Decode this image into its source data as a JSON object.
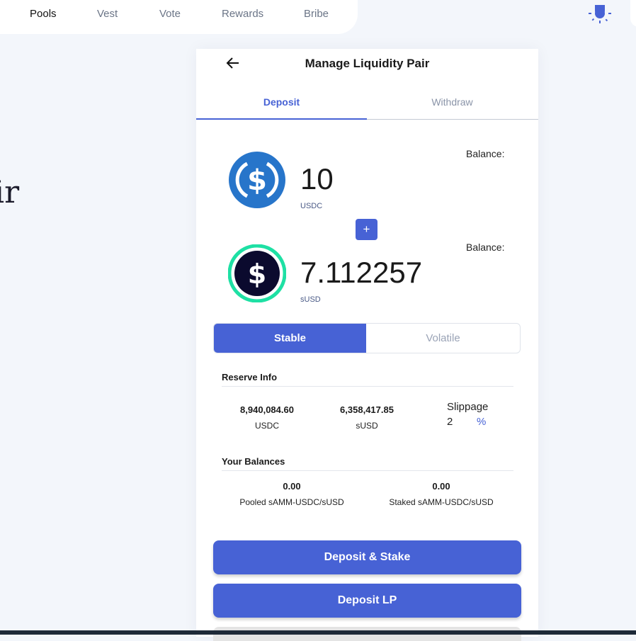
{
  "nav": {
    "items": [
      {
        "label": "Pools",
        "active": true
      },
      {
        "label": "Vest",
        "active": false
      },
      {
        "label": "Vote",
        "active": false
      },
      {
        "label": "Rewards",
        "active": false
      },
      {
        "label": "Bribe",
        "active": false
      }
    ],
    "theme_icon": "sun-icon"
  },
  "background_title_fragment": "ir",
  "card": {
    "back_icon": "arrow-left-icon",
    "title": "Manage Liquidity Pair",
    "tabs": [
      {
        "label": "Deposit",
        "active": true
      },
      {
        "label": "Withdraw",
        "active": false
      }
    ],
    "token_a": {
      "amount": "10",
      "symbol": "USDC",
      "balance_label": "Balance:",
      "icon": "usdc-icon"
    },
    "plus_label": "+",
    "token_b": {
      "amount": "7.112257",
      "symbol": "sUSD",
      "balance_label": "Balance:",
      "icon": "susd-icon"
    },
    "pool_type": {
      "stable": "Stable",
      "volatile": "Volatile",
      "selected": "Stable"
    },
    "reserve": {
      "label": "Reserve Info",
      "token_a_value": "8,940,084.60",
      "token_a_symbol": "USDC",
      "token_b_value": "6,358,417.85",
      "token_b_symbol": "sUSD",
      "slippage_label": "Slippage",
      "slippage_value": "2",
      "slippage_unit": "%"
    },
    "balances": {
      "label": "Your Balances",
      "pooled_value": "0.00",
      "pooled_label": "Pooled sAMM-USDC/sUSD",
      "staked_value": "0.00",
      "staked_label": "Staked sAMM-USDC/sUSD"
    },
    "buttons": {
      "deposit_stake": "Deposit & Stake",
      "deposit_lp": "Deposit LP"
    }
  },
  "colors": {
    "accent": "#4762d5",
    "usdc_blue": "#2775ca",
    "susd_ring": "#1ee0a4",
    "susd_dark": "#0b0a2e"
  }
}
